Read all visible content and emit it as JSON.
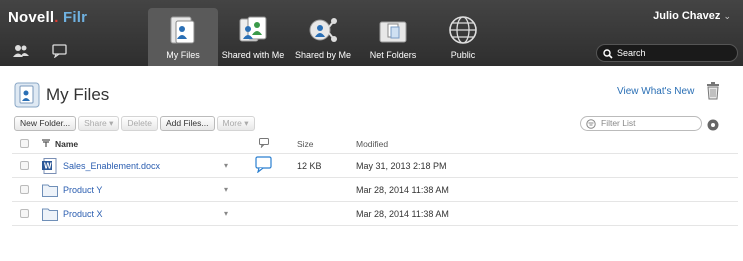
{
  "app": {
    "brand_main": "Novell",
    "brand_product": "Filr"
  },
  "nav": {
    "tabs": [
      {
        "label": "My Files",
        "icon": "my-files-icon",
        "active": true
      },
      {
        "label": "Shared with Me",
        "icon": "shared-with-me-icon",
        "active": false
      },
      {
        "label": "Shared by Me",
        "icon": "shared-by-me-icon",
        "active": false
      },
      {
        "label": "Net Folders",
        "icon": "net-folders-icon",
        "active": false
      },
      {
        "label": "Public",
        "icon": "globe-icon",
        "active": false
      }
    ]
  },
  "user": {
    "name": "Julio Chavez",
    "caret": "⌄"
  },
  "search": {
    "placeholder": "Search"
  },
  "page": {
    "title": "My Files",
    "whats_new": "View What's New"
  },
  "toolbar": {
    "new_folder": "New Folder...",
    "share": "Share ▾",
    "delete": "Delete",
    "add_files": "Add Files...",
    "more": "More ▾"
  },
  "filter": {
    "placeholder": "Filter List"
  },
  "table": {
    "columns": {
      "name": "Name",
      "size": "Size",
      "modified": "Modified"
    },
    "rows": [
      {
        "name": "Sales_Enablement.docx",
        "type": "docx",
        "size": "12 KB",
        "modified": "May 31, 2013 2:18 PM",
        "has_comment": true
      },
      {
        "name": "Product Y",
        "type": "folder",
        "size": "",
        "modified": "Mar 28, 2014 11:38 AM",
        "has_comment": false
      },
      {
        "name": "Product X",
        "type": "folder",
        "size": "",
        "modified": "Mar 28, 2014 11:38 AM",
        "has_comment": false
      }
    ]
  },
  "colors": {
    "topbar": "#333333",
    "link": "#2a5db0",
    "accent_blue": "#6fb1e0"
  }
}
